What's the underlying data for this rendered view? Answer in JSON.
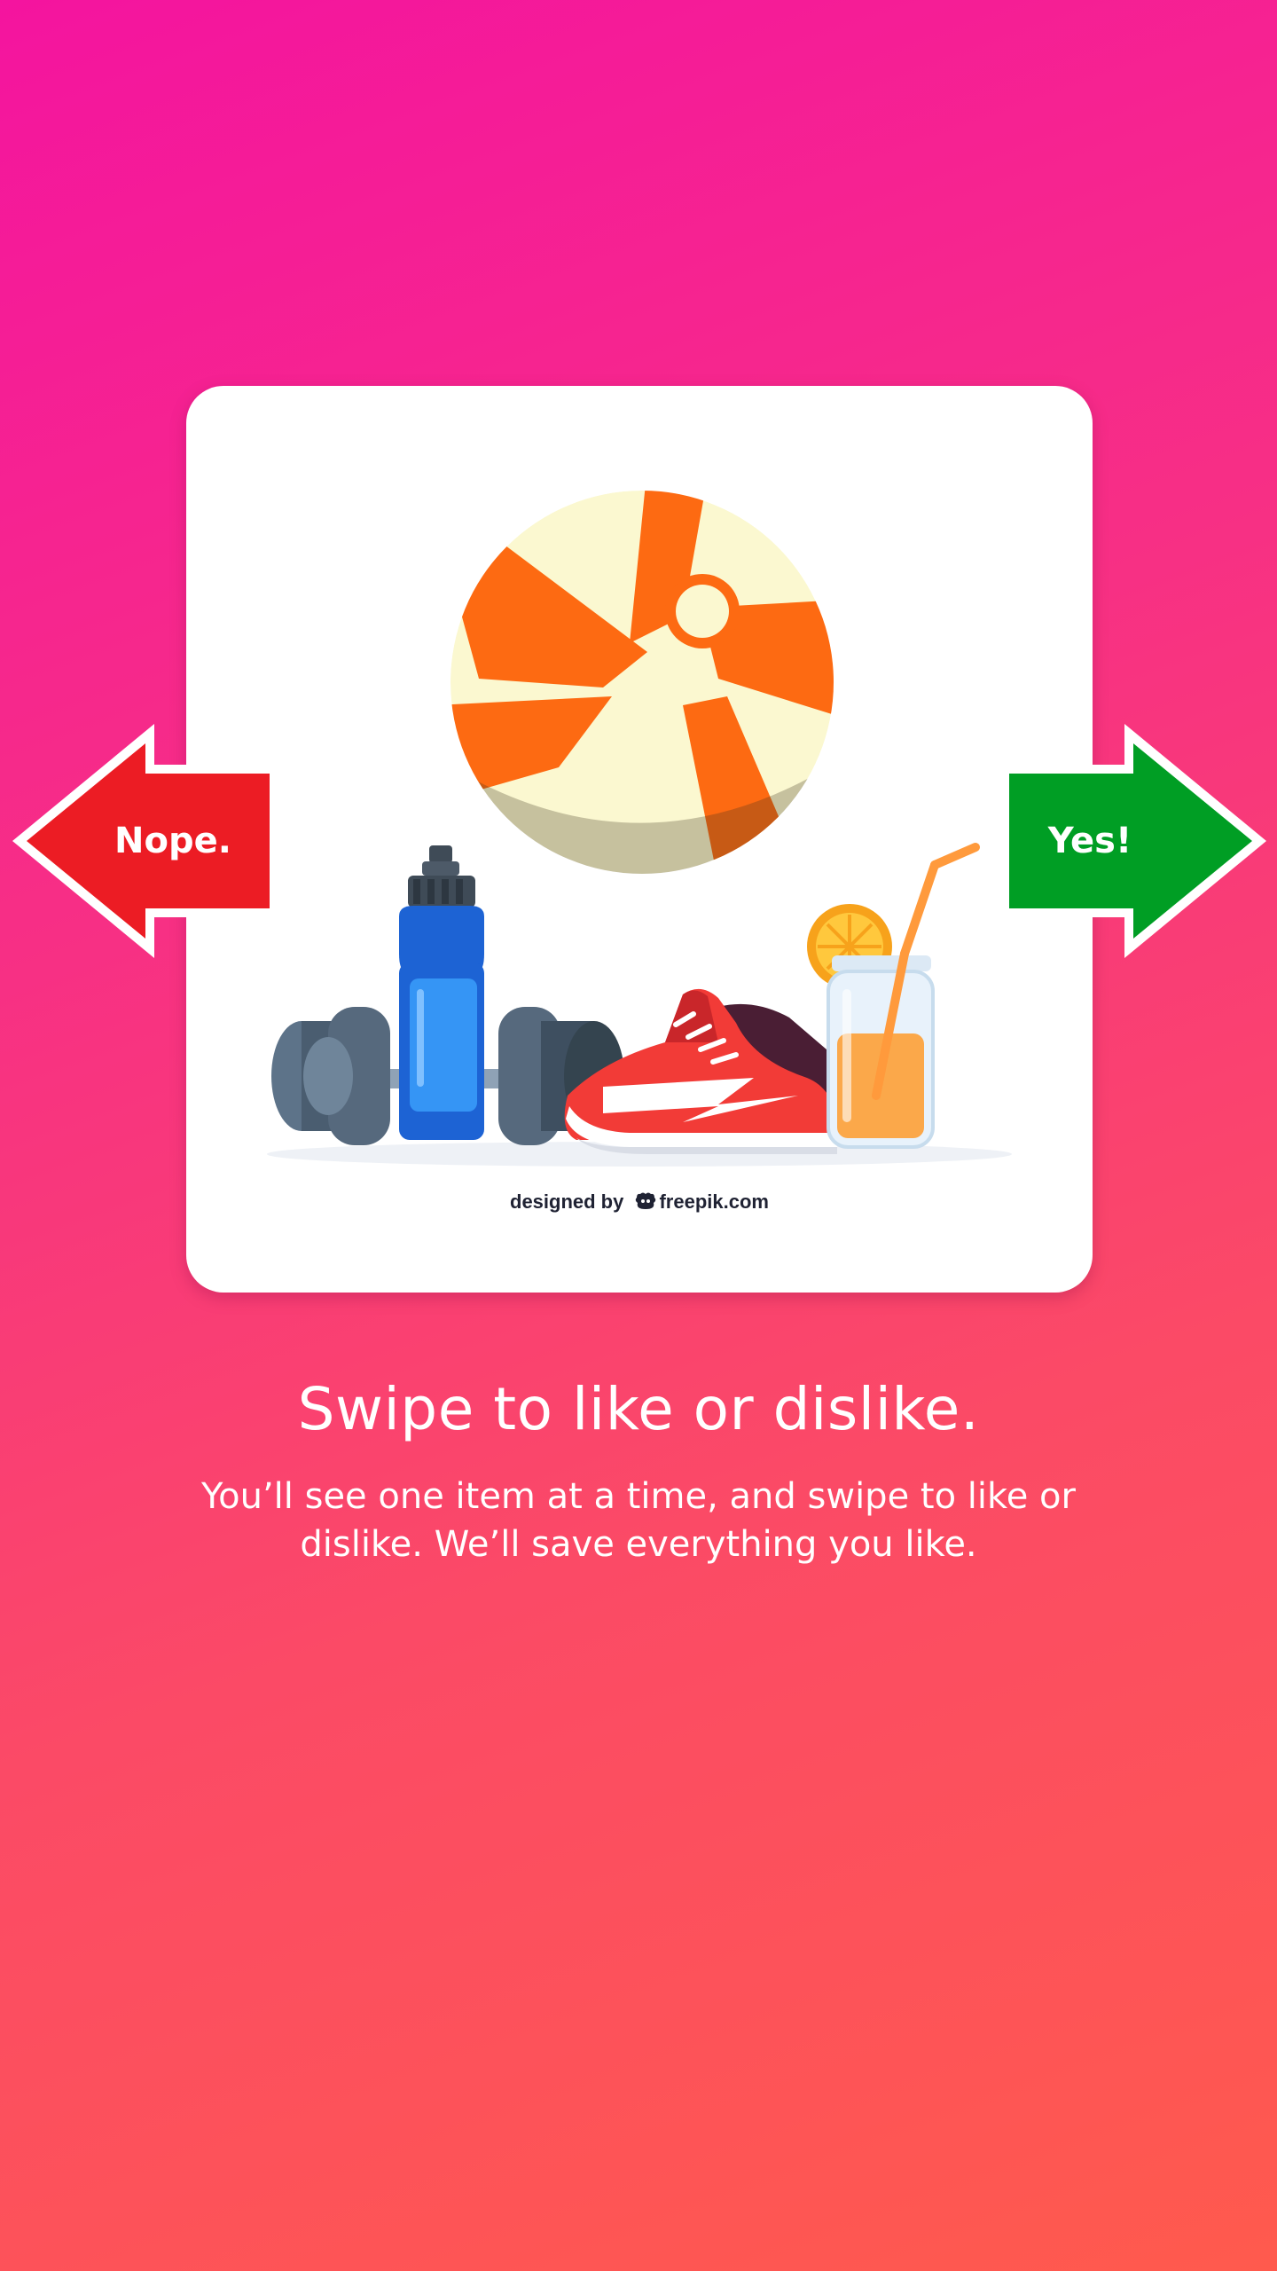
{
  "onboarding": {
    "headline": "Swipe to like or dislike.",
    "body": "You’ll see one item at a time, and swipe to like or dislike. We’ll save everything you like."
  },
  "card": {
    "illustration": "fitness-items",
    "credit_prefix": "designed by",
    "credit_site": "freepik.com"
  },
  "arrows": {
    "left_label": "Nope.",
    "right_label": "Yes!"
  },
  "colors": {
    "background_top": "#f4149f",
    "background_bottom": "#ff5a4d",
    "nope": "#ec1c24",
    "yes": "#009e24"
  }
}
